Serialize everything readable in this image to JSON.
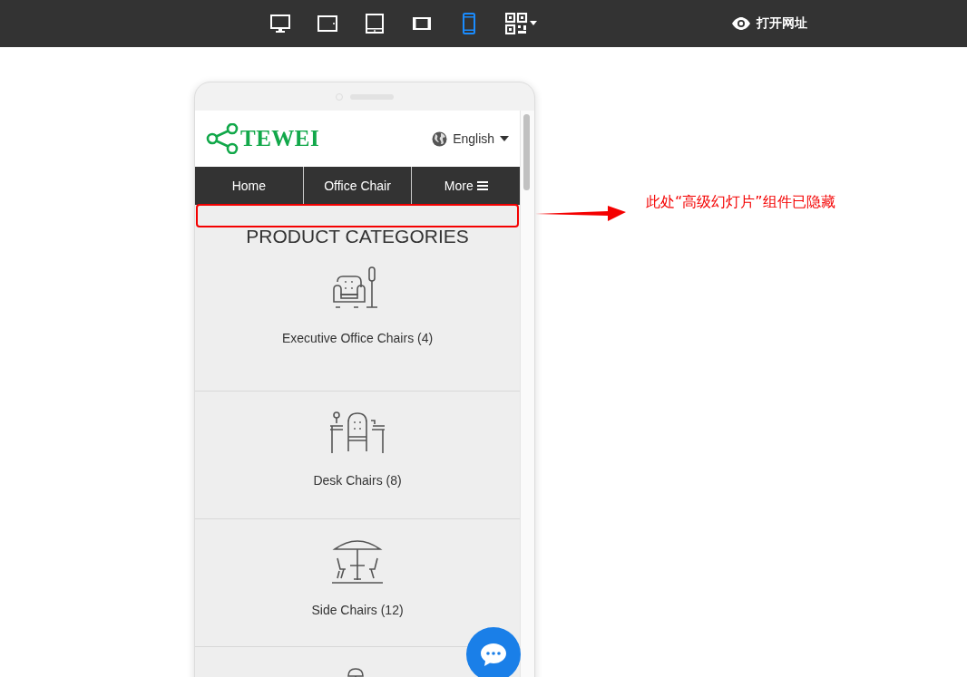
{
  "toolbar": {
    "devices": [
      {
        "kind": "desktop",
        "selected": false
      },
      {
        "kind": "tablet-landscape",
        "selected": false
      },
      {
        "kind": "tablet",
        "selected": false
      },
      {
        "kind": "phone-landscape",
        "selected": false
      },
      {
        "kind": "phone",
        "selected": true
      },
      {
        "kind": "qr",
        "selected": false
      }
    ],
    "open_link": "打开网址"
  },
  "site": {
    "logo_text": "TEWEI",
    "language": "English",
    "nav": [
      {
        "label": "Home"
      },
      {
        "label": "Office Chair"
      },
      {
        "label": "More"
      }
    ],
    "section_title": "PRODUCT CATEGORIES",
    "categories": [
      {
        "kind": "armchair",
        "label": "Executive Office Chairs (4)"
      },
      {
        "kind": "desk",
        "label": "Desk Chairs (8)"
      },
      {
        "kind": "umbrella",
        "label": "Side Chairs (12)"
      },
      {
        "kind": "lamp-table"
      }
    ]
  },
  "annotation": {
    "text": "此处“高级幻灯片”组件已隐藏"
  }
}
